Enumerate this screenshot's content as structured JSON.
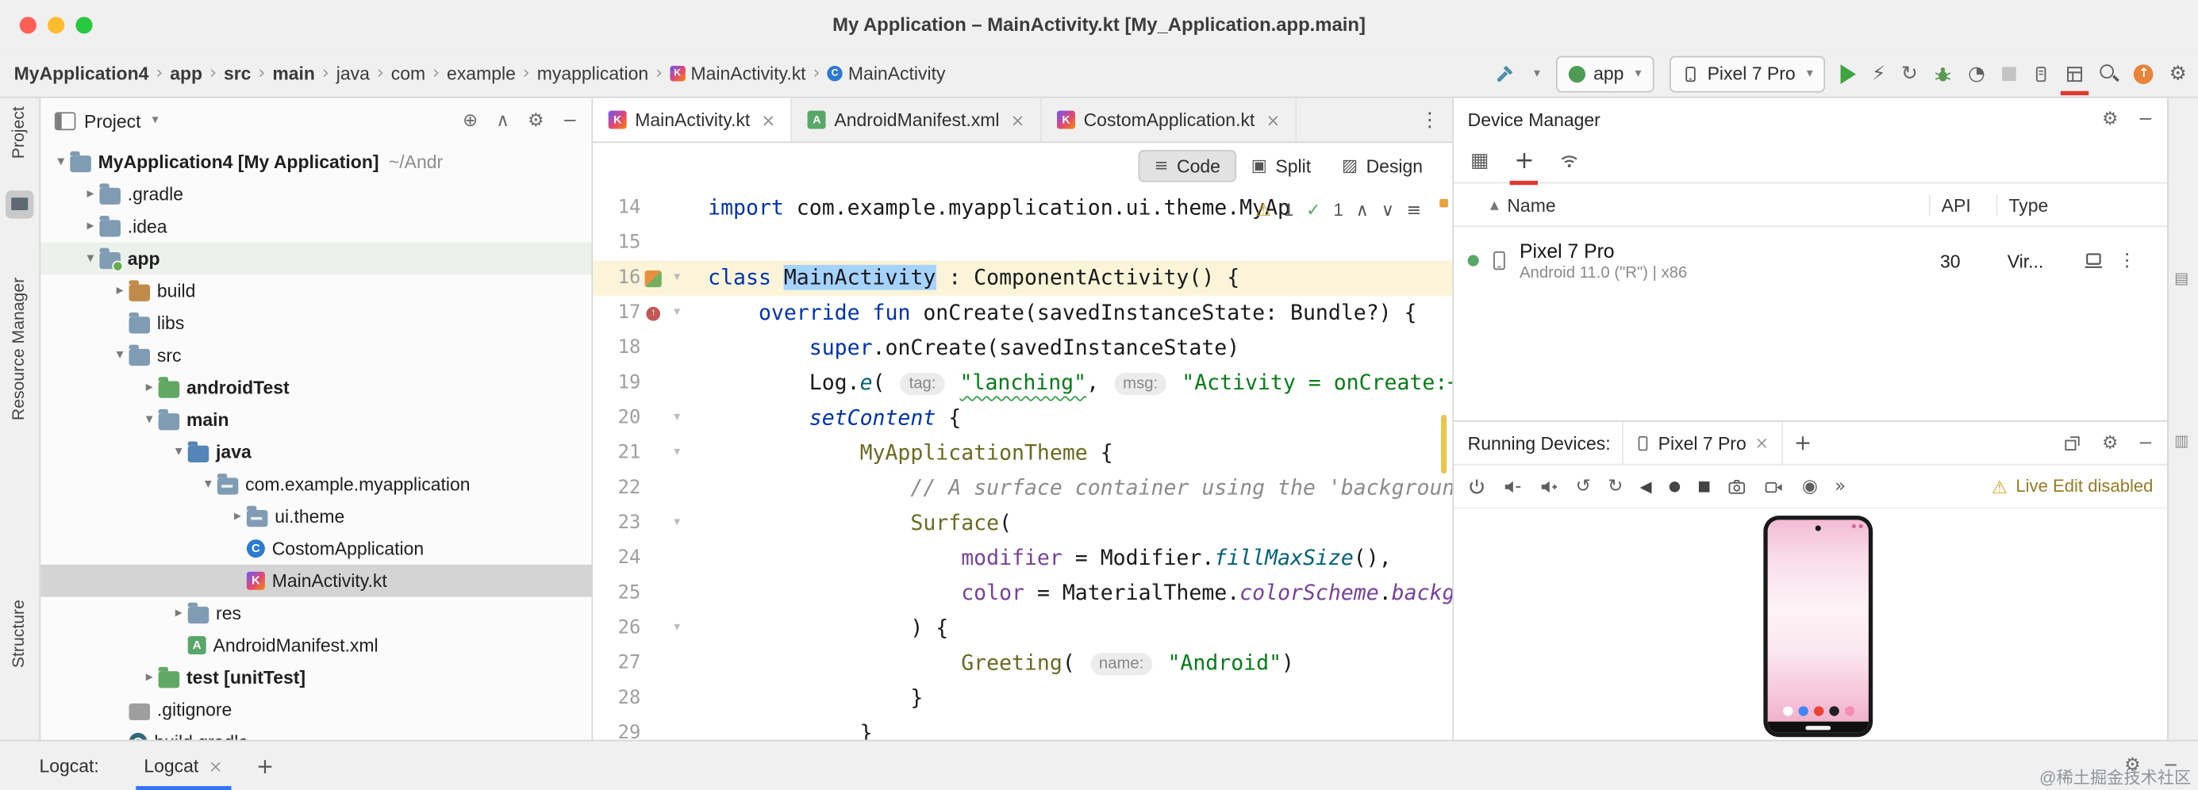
{
  "title_bar": {
    "title": "My Application – MainActivity.kt [My_Application.app.main]"
  },
  "glyphs": {
    "caret": "▾",
    "tri_closed": "▸",
    "chevron": "›",
    "close": "×",
    "plus": "+",
    "minus": "−",
    "gear": "⚙",
    "kebab": "⋮",
    "menu": "≡",
    "sort": "▲",
    "warn": "⚠",
    "check": "✓",
    "up": "∧",
    "down": "∨",
    "back": "◀",
    "home": "●",
    "square": "■",
    "more": "»",
    "rotl": "↺",
    "rotr": "↻",
    "grid": "▦",
    "target": "⊕",
    "bolt": "⚡",
    "profiler": "◔",
    "snapshot": "◉",
    "up_arrow": "↑",
    "code_ic": "≡",
    "split_ic": "▣",
    "design_ic": "▨",
    "stripe1": "▤",
    "stripe2": "▥"
  },
  "breadcrumbs": [
    {
      "label": "MyApplication4",
      "bold": true
    },
    {
      "label": "app",
      "bold": true
    },
    {
      "label": "src",
      "bold": true
    },
    {
      "label": "main",
      "bold": true
    },
    {
      "label": "java"
    },
    {
      "label": "com"
    },
    {
      "label": "example"
    },
    {
      "label": "myapplication"
    },
    {
      "label": "MainActivity.kt",
      "icon": "kotlin"
    },
    {
      "label": "MainActivity",
      "icon": "class"
    }
  ],
  "toolbar": {
    "run_config": "app",
    "device": "Pixel 7 Pro"
  },
  "tool_stripes": {
    "project": "Project",
    "resource_manager": "Resource Manager",
    "structure": "Structure"
  },
  "project": {
    "header": "Project",
    "tree": [
      {
        "level": 0,
        "arrow": "open",
        "icon": "folder",
        "label": "MyApplication4 [My Application]",
        "bold": true,
        "hint": "~/Andr"
      },
      {
        "level": 1,
        "arrow": "closed",
        "icon": "folder",
        "label": ".gradle"
      },
      {
        "level": 1,
        "arrow": "closed",
        "icon": "folder",
        "label": ".idea"
      },
      {
        "level": 1,
        "arrow": "open",
        "icon": "module",
        "label": "app",
        "bold": true,
        "hl": true
      },
      {
        "level": 2,
        "arrow": "closed",
        "icon": "build",
        "label": "build"
      },
      {
        "level": 2,
        "arrow": "none",
        "icon": "folder",
        "label": "libs"
      },
      {
        "level": 2,
        "arrow": "open",
        "icon": "folder",
        "label": "src"
      },
      {
        "level": 3,
        "arrow": "closed",
        "icon": "test",
        "label": "androidTest",
        "bold": true
      },
      {
        "level": 3,
        "arrow": "open",
        "icon": "folder",
        "label": "main",
        "bold": true
      },
      {
        "level": 4,
        "arrow": "open",
        "icon": "srcf",
        "label": "java",
        "bold": true
      },
      {
        "level": 5,
        "arrow": "open",
        "icon": "pkg",
        "label": "com.example.myapplication"
      },
      {
        "level": 6,
        "arrow": "closed",
        "icon": "pkg",
        "label": "ui.theme"
      },
      {
        "level": 6,
        "arrow": "none",
        "icon": "class",
        "label": "CostomApplication"
      },
      {
        "level": 6,
        "arrow": "none",
        "icon": "kotlin",
        "label": "MainActivity.kt",
        "selected": true
      },
      {
        "level": 4,
        "arrow": "closed",
        "icon": "folder",
        "label": "res"
      },
      {
        "level": 4,
        "arrow": "none",
        "icon": "manifest",
        "label": "AndroidManifest.xml"
      },
      {
        "level": 3,
        "arrow": "closed",
        "icon": "test",
        "label": "test [unitTest]",
        "bold": true
      },
      {
        "level": 2,
        "arrow": "none",
        "icon": "ignore",
        "label": ".gitignore"
      },
      {
        "level": 2,
        "arrow": "none",
        "icon": "gradle",
        "label": "build.gradle"
      }
    ]
  },
  "editor": {
    "tabs": [
      {
        "label": "MainActivity.kt",
        "icon": "kotlin",
        "active": true
      },
      {
        "label": "AndroidManifest.xml",
        "icon": "manifest"
      },
      {
        "label": "CostomApplication.kt",
        "icon": "kotlin"
      }
    ],
    "view_modes": {
      "code": "Code",
      "split": "Split",
      "design": "Design"
    },
    "inspections": {
      "warnings": "1",
      "passed": "1"
    },
    "lines": [
      {
        "n": "14",
        "seg": [
          [
            "k",
            "import"
          ],
          [
            "p",
            " com.example.myapplication.ui.theme.MyAp"
          ]
        ]
      },
      {
        "n": "15",
        "seg": []
      },
      {
        "n": "16",
        "hl": true,
        "gicon": "android",
        "fold": true,
        "seg": [
          [
            "k",
            "class"
          ],
          [
            "p",
            " "
          ],
          [
            "sel",
            "MainActivity"
          ],
          [
            "p",
            " : ComponentActivity() {"
          ]
        ]
      },
      {
        "n": "17",
        "gicon": "override",
        "fold": true,
        "seg": [
          [
            "p",
            "    "
          ],
          [
            "k",
            "override"
          ],
          [
            "p",
            " "
          ],
          [
            "k",
            "fun"
          ],
          [
            "p",
            " onCreate(savedInstanceState: Bundle?) {"
          ]
        ]
      },
      {
        "n": "18",
        "seg": [
          [
            "p",
            "        "
          ],
          [
            "k",
            "super"
          ],
          [
            "p",
            ".onCreate(savedInstanceState)"
          ]
        ]
      },
      {
        "n": "19",
        "seg": [
          [
            "p",
            "        Log."
          ],
          [
            "f",
            "e"
          ],
          [
            "p",
            "( "
          ],
          [
            "h",
            "tag:"
          ],
          [
            "p",
            " "
          ],
          [
            "su",
            "\"lanching\""
          ],
          [
            "p",
            ", "
          ],
          [
            "h",
            "msg:"
          ],
          [
            "p",
            " "
          ],
          [
            "s",
            "\"Activity = onCreate:++"
          ]
        ]
      },
      {
        "n": "20",
        "fold": true,
        "seg": [
          [
            "p",
            "        "
          ],
          [
            "f2",
            "setContent"
          ],
          [
            "p",
            " {"
          ]
        ]
      },
      {
        "n": "21",
        "fold": true,
        "seg": [
          [
            "p",
            "            "
          ],
          [
            "m",
            "MyApplicationTheme"
          ],
          [
            "p",
            " {"
          ]
        ]
      },
      {
        "n": "22",
        "seg": [
          [
            "c",
            "                // A surface container using the 'backgroun"
          ]
        ]
      },
      {
        "n": "23",
        "fold": true,
        "seg": [
          [
            "p",
            "                "
          ],
          [
            "m",
            "Surface"
          ],
          [
            "p",
            "("
          ]
        ]
      },
      {
        "n": "24",
        "seg": [
          [
            "p",
            "                    "
          ],
          [
            "a",
            "modifier"
          ],
          [
            "p",
            " = Modifier."
          ],
          [
            "f",
            "fillMaxSize"
          ],
          [
            "p",
            "(),"
          ]
        ]
      },
      {
        "n": "25",
        "seg": [
          [
            "p",
            "                    "
          ],
          [
            "a",
            "color"
          ],
          [
            "p",
            " = MaterialTheme."
          ],
          [
            "pi",
            "colorScheme"
          ],
          [
            "p",
            "."
          ],
          [
            "pi",
            "backgr"
          ]
        ]
      },
      {
        "n": "26",
        "fold": true,
        "seg": [
          [
            "p",
            "                ) {"
          ]
        ]
      },
      {
        "n": "27",
        "seg": [
          [
            "p",
            "                    "
          ],
          [
            "m",
            "Greeting"
          ],
          [
            "p",
            "( "
          ],
          [
            "h",
            "name:"
          ],
          [
            "p",
            " "
          ],
          [
            "s",
            "\"Android\""
          ],
          [
            "p",
            ")"
          ]
        ]
      },
      {
        "n": "28",
        "seg": [
          [
            "p",
            "                }"
          ]
        ]
      },
      {
        "n": "29",
        "seg": [
          [
            "p",
            "            }"
          ]
        ]
      }
    ]
  },
  "device_manager": {
    "title": "Device Manager",
    "columns": {
      "name": "Name",
      "api": "API",
      "type": "Type"
    },
    "device": {
      "name": "Pixel 7 Pro",
      "details": "Android 11.0 (\"R\") | x86",
      "api": "30",
      "type": "Vir..."
    }
  },
  "running_devices": {
    "title": "Running Devices:",
    "tab": "Pixel 7 Pro",
    "live_edit": "Live Edit disabled"
  },
  "bottom_bar": {
    "label": "Logcat:",
    "tab": "Logcat"
  },
  "watermark": "@稀土掘金技术社区"
}
